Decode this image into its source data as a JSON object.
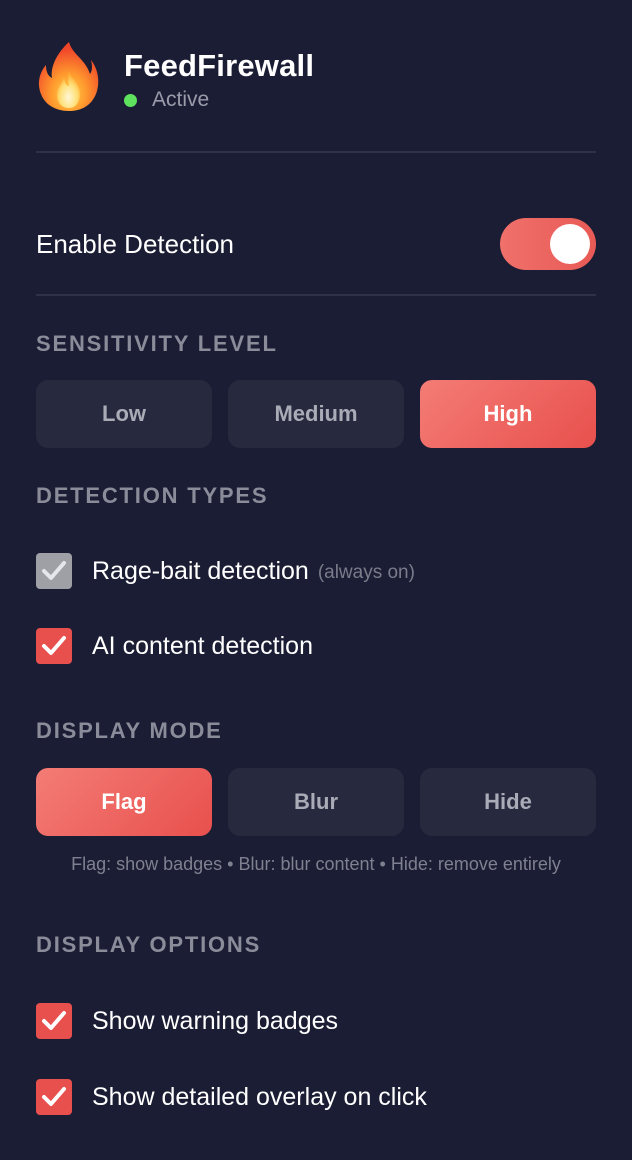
{
  "header": {
    "app_name": "FeedFirewall",
    "status_text": "Active",
    "logo_icon": "fire-icon",
    "status_color": "#5fe35f"
  },
  "enable_detection": {
    "label": "Enable Detection",
    "enabled": true
  },
  "sensitivity": {
    "title": "SENSITIVITY LEVEL",
    "options": [
      "Low",
      "Medium",
      "High"
    ],
    "selected": "High"
  },
  "detection_types": {
    "title": "DETECTION TYPES",
    "items": [
      {
        "label": "Rage-bait detection",
        "hint": "(always on)",
        "checked": true,
        "disabled": true
      },
      {
        "label": "AI content detection",
        "checked": true,
        "disabled": false
      }
    ]
  },
  "display_mode": {
    "title": "DISPLAY MODE",
    "options": [
      "Flag",
      "Blur",
      "Hide"
    ],
    "selected": "Flag",
    "help_text": "Flag: show badges • Blur: blur content • Hide: remove entirely"
  },
  "display_options": {
    "title": "DISPLAY OPTIONS",
    "items": [
      {
        "label": "Show warning badges",
        "checked": true
      },
      {
        "label": "Show detailed overlay on click",
        "checked": true
      }
    ]
  },
  "colors": {
    "accent": "#e8504d",
    "background": "#1a1d33",
    "button_inactive": "#272a3e"
  }
}
